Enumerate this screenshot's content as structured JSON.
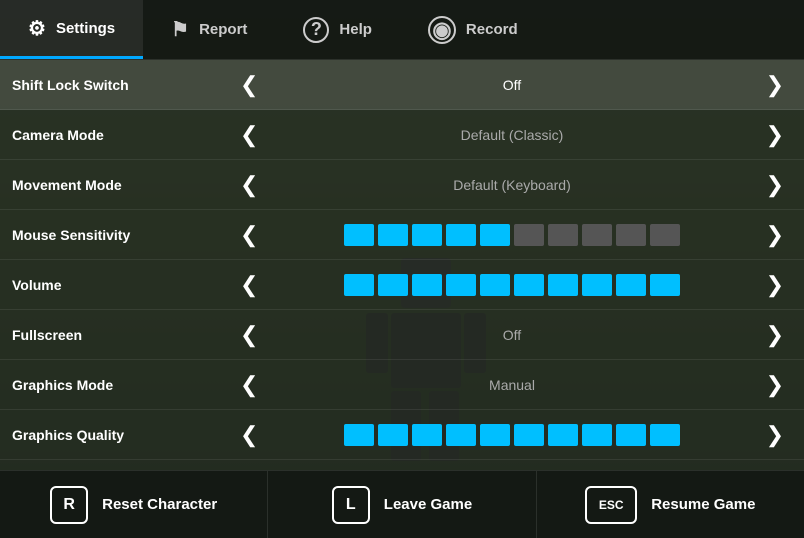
{
  "nav": {
    "items": [
      {
        "id": "settings",
        "label": "Settings",
        "icon": "⚙",
        "active": true
      },
      {
        "id": "report",
        "label": "Report",
        "icon": "⚑",
        "active": false
      },
      {
        "id": "help",
        "label": "Help",
        "icon": "?",
        "active": false
      },
      {
        "id": "record",
        "label": "Record",
        "icon": "⊙",
        "active": false
      }
    ]
  },
  "settings": {
    "rows": [
      {
        "id": "shift-lock",
        "label": "Shift Lock Switch",
        "type": "toggle",
        "value": "Off",
        "highlighted": true
      },
      {
        "id": "camera-mode",
        "label": "Camera Mode",
        "type": "toggle",
        "value": "Default (Classic)",
        "highlighted": false
      },
      {
        "id": "movement-mode",
        "label": "Movement Mode",
        "type": "toggle",
        "value": "Default (Keyboard)",
        "highlighted": false
      },
      {
        "id": "mouse-sensitivity",
        "label": "Mouse Sensitivity",
        "type": "slider",
        "filledDots": 5,
        "totalDots": 10,
        "highlighted": false
      },
      {
        "id": "volume",
        "label": "Volume",
        "type": "slider",
        "filledDots": 10,
        "totalDots": 10,
        "highlighted": false
      },
      {
        "id": "fullscreen",
        "label": "Fullscreen",
        "type": "toggle",
        "value": "Off",
        "highlighted": false
      },
      {
        "id": "graphics-mode",
        "label": "Graphics Mode",
        "type": "toggle",
        "value": "Manual",
        "highlighted": false
      },
      {
        "id": "graphics-quality",
        "label": "Graphics Quality",
        "type": "slider",
        "filledDots": 10,
        "totalDots": 10,
        "highlighted": false
      }
    ]
  },
  "actions": [
    {
      "id": "reset",
      "key": "R",
      "label": "Reset Character"
    },
    {
      "id": "leave",
      "key": "L",
      "label": "Leave Game"
    },
    {
      "id": "resume",
      "key": "ESC",
      "label": "Resume Game"
    }
  ],
  "icons": {
    "settings": "⚙",
    "report": "⚑",
    "help": "?",
    "record": "◎",
    "arrow_left": "❮",
    "arrow_right": "❯"
  }
}
